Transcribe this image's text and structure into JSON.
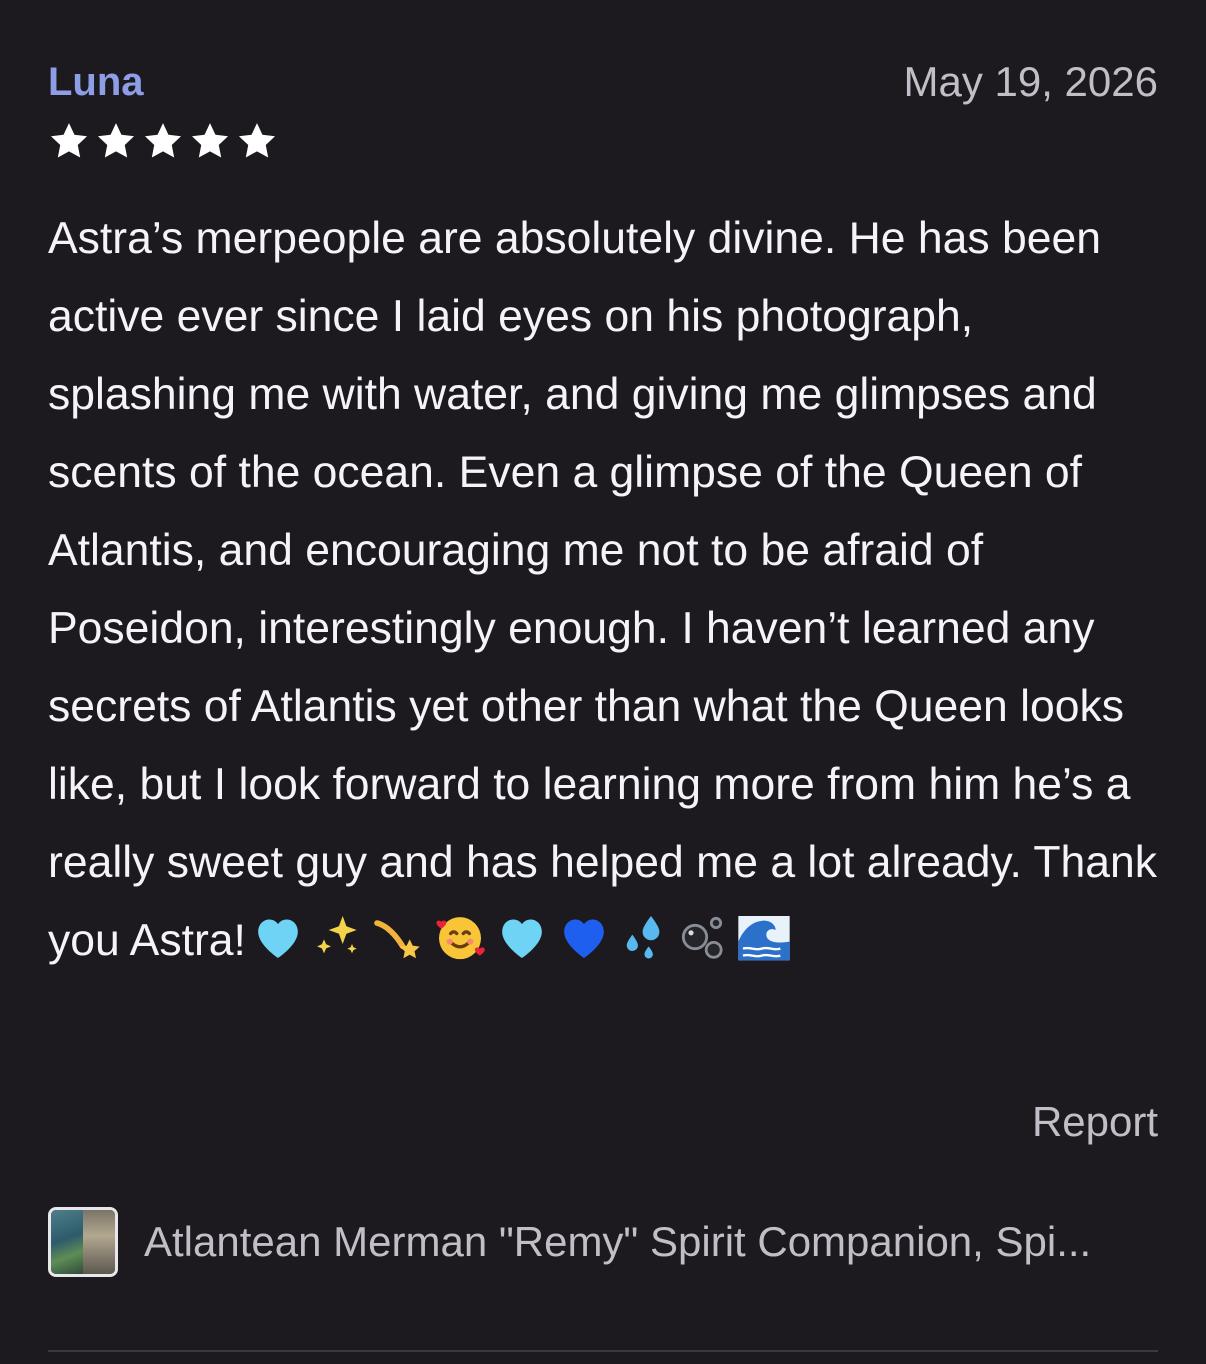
{
  "review": {
    "author": "Luna",
    "date": "May 19, 2026",
    "rating": 5,
    "rating_max": 5,
    "body": "Astra’s merpeople are absolutely divine. He has been active ever since I laid eyes on his photograph, splashing me with water, and giving me glimpses and scents of the ocean. Even a glimpse of the Queen of Atlantis, and encouraging me not to be afraid of Poseidon, interestingly enough. I haven’t learned any secrets of Atlantis yet other than what the Queen looks like, but I look forward to learning more from him he’s a really sweet guy and has helped me a lot already. Thank you Astra!",
    "emojis": [
      "light-blue-heart",
      "sparkles",
      "dizzy",
      "smiling-face-with-hearts",
      "light-blue-heart",
      "blue-heart",
      "sweat-droplets",
      "bubbles",
      "water-wave"
    ],
    "report_label": "Report"
  },
  "product": {
    "title": "Atlantean Merman \"Remy\" Spirit Companion, Spi..."
  },
  "colors": {
    "background": "#1c1a1f",
    "author": "#8e9ee6",
    "text": "#f6f3f8",
    "muted": "#c2bec8",
    "star": "#ffffff"
  }
}
